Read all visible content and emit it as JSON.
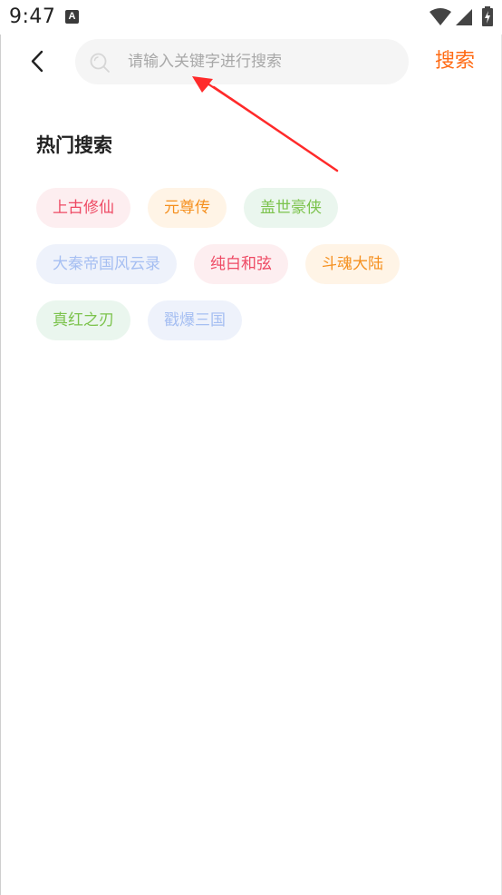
{
  "status_bar": {
    "time": "9:47",
    "notification_icon": "A",
    "icons": [
      "wifi-icon",
      "signal-icon",
      "battery-icon"
    ]
  },
  "header": {
    "back_icon": "chevron-left-icon",
    "search": {
      "placeholder": "请输入关键字进行搜索",
      "value": "",
      "icon": "search-icon"
    },
    "search_button_label": "搜索"
  },
  "hot_search": {
    "title": "热门搜索",
    "tags": [
      {
        "label": "上古修仙",
        "color": "#ee4a64"
      },
      {
        "label": "元尊传",
        "color": "#f5901f"
      },
      {
        "label": "盖世豪侠",
        "color": "#7cc34d"
      },
      {
        "label": "大秦帝国风云录",
        "color": "#a6bff2"
      },
      {
        "label": "纯白和弦",
        "color": "#ee4a64"
      },
      {
        "label": "斗魂大陆",
        "color": "#f5901f"
      },
      {
        "label": "真红之刃",
        "color": "#7cc34d"
      },
      {
        "label": "戳爆三国",
        "color": "#a6bff2"
      }
    ]
  },
  "colors": {
    "accent": "#ff6a13",
    "annotation": "#ff2a2a"
  }
}
